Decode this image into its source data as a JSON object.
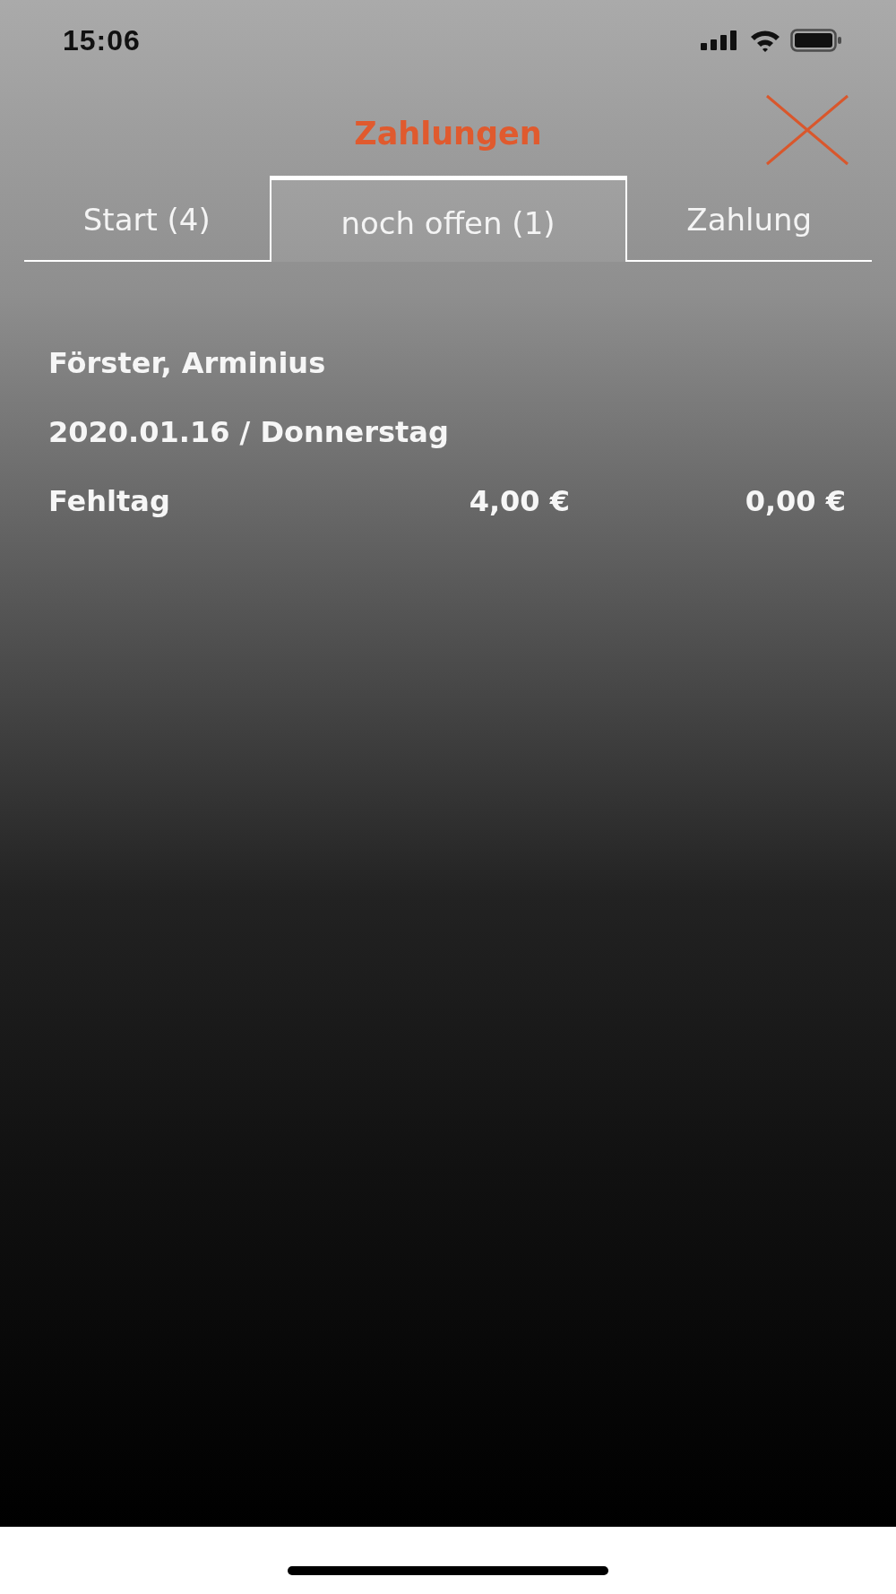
{
  "status_bar": {
    "time": "15:06"
  },
  "header": {
    "title": "Zahlungen"
  },
  "tabs": [
    {
      "label": "Start (4)",
      "selected": false
    },
    {
      "label": "noch offen (1)",
      "selected": true
    },
    {
      "label": "Zahlung",
      "selected": false
    }
  ],
  "entry": {
    "name": "Förster, Arminius",
    "date": "2020.01.16 / Donnerstag",
    "row": {
      "type": "Fehltag",
      "amount": "4,00 €",
      "paid": "0,00 €"
    }
  }
}
